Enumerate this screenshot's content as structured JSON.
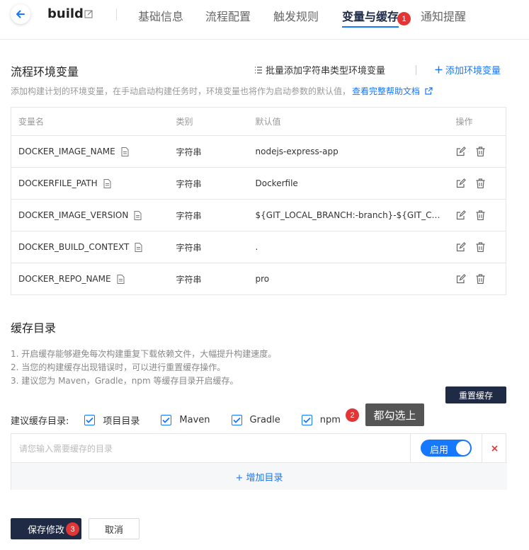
{
  "header": {
    "project_name": "build",
    "tabs": [
      {
        "label": "基础信息"
      },
      {
        "label": "流程配置"
      },
      {
        "label": "触发规则"
      },
      {
        "label": "变量与缓存"
      },
      {
        "label": "通知提醒"
      }
    ],
    "active_tab_badge": "1"
  },
  "env": {
    "title": "流程环境变量",
    "batch_add_label": "批量添加字符串类型环境变量",
    "add_label": "添加环境变量",
    "hint": "添加构建计划的环境变量，在手动启动构建任务时，环境变量也将作为启动参数的默认值，",
    "help_link": "查看完整帮助文档",
    "columns": [
      "变量名",
      "类别",
      "默认值",
      "操作"
    ],
    "rows": [
      {
        "name": "DOCKER_IMAGE_NAME",
        "type": "字符串",
        "default": "nodejs-express-app"
      },
      {
        "name": "DOCKERFILE_PATH",
        "type": "字符串",
        "default": "Dockerfile"
      },
      {
        "name": "DOCKER_IMAGE_VERSION",
        "type": "字符串",
        "default": "${GIT_LOCAL_BRANCH:-branch}-${GIT_COM..."
      },
      {
        "name": "DOCKER_BUILD_CONTEXT",
        "type": "字符串",
        "default": "."
      },
      {
        "name": "DOCKER_REPO_NAME",
        "type": "字符串",
        "default": "pro"
      }
    ]
  },
  "cache": {
    "title": "缓存目录",
    "desc": [
      "1. 开启缓存能够避免每次构建重复下载依赖文件，大幅提升构建速度。",
      "2. 当您的构建缓存出现错误时，可以进行重置缓存操作。",
      "3. 建议您为 Maven，Gradle，npm 等缓存目录开启缓存。"
    ],
    "reset_label": "重置缓存",
    "suggest_label": "建议缓存目录:",
    "options": [
      {
        "label": "项目目录",
        "checked": true
      },
      {
        "label": "Maven",
        "checked": true
      },
      {
        "label": "Gradle",
        "checked": true
      },
      {
        "label": "npm",
        "checked": true
      }
    ],
    "npm_badge": "2",
    "tooltip": "都勾选上",
    "input_placeholder": "请您输入需要缓存的目录",
    "toggle_label": "启用",
    "toggle_on": true,
    "add_dir_label": "+ 增加目录"
  },
  "footer": {
    "save_label": "保存修改",
    "save_badge": "3",
    "cancel_label": "取消"
  },
  "colors": {
    "primary": "#1677ff",
    "dark_button": "#1f2a44",
    "badge": "#e23636"
  }
}
